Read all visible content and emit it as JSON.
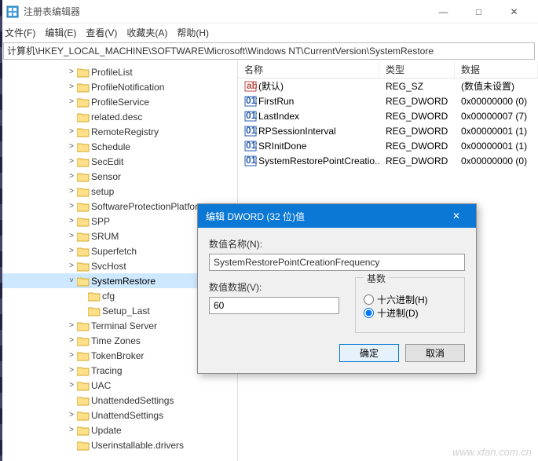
{
  "window": {
    "title": "注册表编辑器",
    "min": "—",
    "max": "□",
    "close": "✕"
  },
  "menubar": {
    "file": "文件(F)",
    "edit": "编辑(E)",
    "view": "查看(V)",
    "favorites": "收藏夹(A)",
    "help": "帮助(H)"
  },
  "address": "计算机\\HKEY_LOCAL_MACHINE\\SOFTWARE\\Microsoft\\Windows NT\\CurrentVersion\\SystemRestore",
  "columns": {
    "name": "名称",
    "type": "类型",
    "data": "数据"
  },
  "tree": [
    {
      "label": "ProfileList",
      "depth": 6,
      "expandable": true
    },
    {
      "label": "ProfileNotification",
      "depth": 6,
      "expandable": true
    },
    {
      "label": "ProfileService",
      "depth": 6,
      "expandable": true
    },
    {
      "label": "related.desc",
      "depth": 6,
      "expandable": false
    },
    {
      "label": "RemoteRegistry",
      "depth": 6,
      "expandable": true
    },
    {
      "label": "Schedule",
      "depth": 6,
      "expandable": true
    },
    {
      "label": "SecEdit",
      "depth": 6,
      "expandable": true
    },
    {
      "label": "Sensor",
      "depth": 6,
      "expandable": true
    },
    {
      "label": "setup",
      "depth": 6,
      "expandable": true
    },
    {
      "label": "SoftwareProtectionPlatform",
      "depth": 6,
      "expandable": true
    },
    {
      "label": "SPP",
      "depth": 6,
      "expandable": true
    },
    {
      "label": "SRUM",
      "depth": 6,
      "expandable": true
    },
    {
      "label": "Superfetch",
      "depth": 6,
      "expandable": true
    },
    {
      "label": "SvcHost",
      "depth": 6,
      "expandable": true
    },
    {
      "label": "SystemRestore",
      "depth": 6,
      "expandable": true,
      "expanded": true,
      "selected": true
    },
    {
      "label": "cfg",
      "depth": 7,
      "expandable": false
    },
    {
      "label": "Setup_Last",
      "depth": 7,
      "expandable": false
    },
    {
      "label": "Terminal Server",
      "depth": 6,
      "expandable": true
    },
    {
      "label": "Time Zones",
      "depth": 6,
      "expandable": true
    },
    {
      "label": "TokenBroker",
      "depth": 6,
      "expandable": true
    },
    {
      "label": "Tracing",
      "depth": 6,
      "expandable": true
    },
    {
      "label": "UAC",
      "depth": 6,
      "expandable": true
    },
    {
      "label": "UnattendedSettings",
      "depth": 6,
      "expandable": false
    },
    {
      "label": "UnattendSettings",
      "depth": 6,
      "expandable": true
    },
    {
      "label": "Update",
      "depth": 6,
      "expandable": true
    },
    {
      "label": "Userinstallable.drivers",
      "depth": 6,
      "expandable": false
    }
  ],
  "values": [
    {
      "icon": "sz",
      "name": "(默认)",
      "type": "REG_SZ",
      "data": "(数值未设置)"
    },
    {
      "icon": "dw",
      "name": "FirstRun",
      "type": "REG_DWORD",
      "data": "0x00000000 (0)"
    },
    {
      "icon": "dw",
      "name": "LastIndex",
      "type": "REG_DWORD",
      "data": "0x00000007 (7)"
    },
    {
      "icon": "dw",
      "name": "RPSessionInterval",
      "type": "REG_DWORD",
      "data": "0x00000001 (1)"
    },
    {
      "icon": "dw",
      "name": "SRInitDone",
      "type": "REG_DWORD",
      "data": "0x00000001 (1)"
    },
    {
      "icon": "dw",
      "name": "SystemRestorePointCreatio...",
      "type": "REG_DWORD",
      "data": "0x00000000 (0)"
    }
  ],
  "dialog": {
    "title": "编辑 DWORD (32 位)值",
    "name_label": "数值名称(N):",
    "name_value": "SystemRestorePointCreationFrequency",
    "data_label": "数值数据(V):",
    "data_value": "60",
    "base_legend": "基数",
    "radio_hex": "十六进制(H)",
    "radio_dec": "十进制(D)",
    "ok": "确定",
    "cancel": "取消",
    "close_x": "✕"
  },
  "watermark": "www.xfan.com.cn"
}
